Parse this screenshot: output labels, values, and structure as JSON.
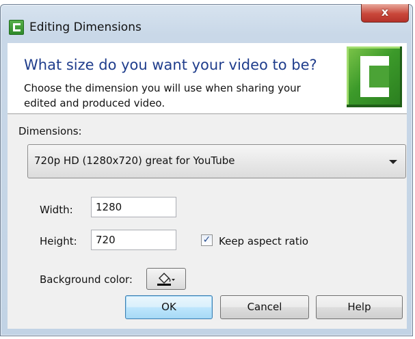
{
  "window": {
    "title": "Editing Dimensions",
    "close_label": "x",
    "app_icon": "camtasia-c-icon"
  },
  "header": {
    "heading": "What size do you want your video to be?",
    "subtext": "Choose the dimension you will use when sharing your edited and produced video.",
    "logo_icon": "camtasia-logo"
  },
  "dimensions": {
    "label": "Dimensions:",
    "selected": "720p HD (1280x720) great for YouTube"
  },
  "width": {
    "label": "Width:",
    "value": "1280"
  },
  "height": {
    "label": "Height:",
    "value": "720"
  },
  "aspect": {
    "label": "Keep aspect ratio",
    "checked": true,
    "check_glyph": "✓"
  },
  "background": {
    "label": "Background color:",
    "icon": "paint-bucket-icon"
  },
  "buttons": {
    "ok": "OK",
    "cancel": "Cancel",
    "help": "Help"
  },
  "colors": {
    "heading": "#1f3d8c",
    "close": "#c9473a",
    "logo_green": "#3c9a2a"
  }
}
